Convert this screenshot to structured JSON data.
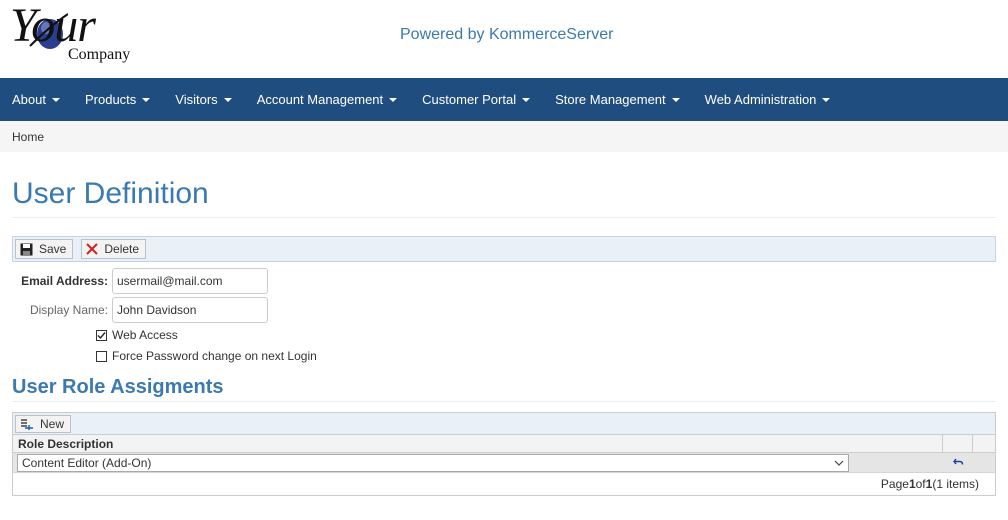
{
  "header": {
    "logo_word": "Your",
    "logo_company": "Company",
    "powered_by": "Powered by KommerceServer"
  },
  "nav": {
    "items": [
      {
        "label": "About"
      },
      {
        "label": "Products"
      },
      {
        "label": "Visitors"
      },
      {
        "label": "Account Management"
      },
      {
        "label": "Customer Portal"
      },
      {
        "label": "Store Management"
      },
      {
        "label": "Web Administration"
      }
    ]
  },
  "breadcrumb": {
    "home": "Home"
  },
  "page": {
    "title": "User Definition"
  },
  "toolbar": {
    "save_label": "Save",
    "delete_label": "Delete"
  },
  "form": {
    "email_label": "Email Address:",
    "email_value": "usermail@mail.com",
    "display_label": "Display Name:",
    "display_value": "John Davidson",
    "web_access_label": "Web Access",
    "web_access_checked": true,
    "force_pw_label": "Force Password change on next Login",
    "force_pw_checked": false
  },
  "roles": {
    "title": "User Role Assigments",
    "new_label": "New",
    "column_header": "Role Description",
    "rows": [
      {
        "role": "Content Editor (Add-On)"
      }
    ],
    "pager": {
      "prefix": "Page ",
      "page": "1",
      "of": " of ",
      "total": "1",
      "suffix": " (1 items)"
    }
  },
  "colors": {
    "nav_bg": "#1f4d80",
    "title": "#3a7ab0",
    "toolbar_bg": "#eaf0f7"
  }
}
